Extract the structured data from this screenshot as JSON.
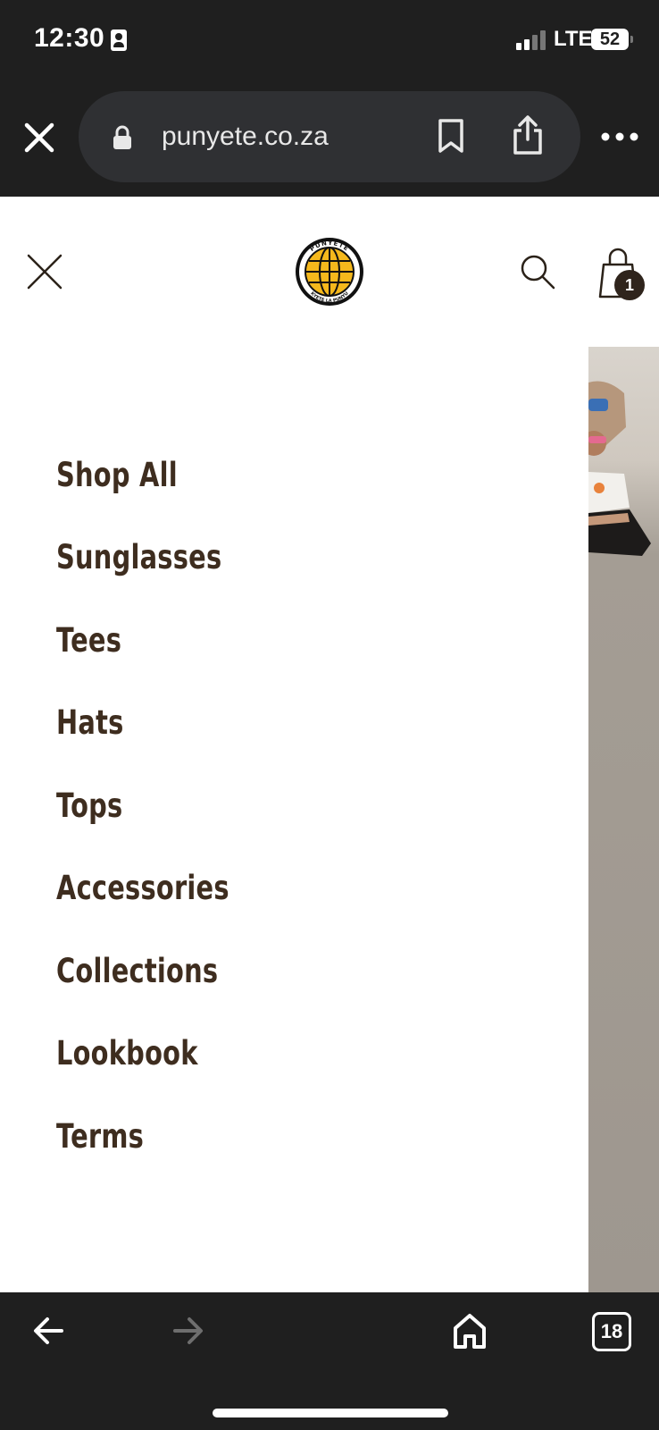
{
  "status_bar": {
    "time": "12:30",
    "network": "LTE",
    "battery": "52"
  },
  "browser": {
    "url": "punyete.co.za",
    "tab_count": "18"
  },
  "site": {
    "logo_text_top": "PUNYETE",
    "logo_text_bottom": "KYETE LA PUNYU",
    "cart_count": "1"
  },
  "menu": {
    "items": [
      {
        "label": "Shop All"
      },
      {
        "label": "Sunglasses"
      },
      {
        "label": "Tees"
      },
      {
        "label": "Hats"
      },
      {
        "label": "Tops"
      },
      {
        "label": "Accessories"
      },
      {
        "label": "Collections"
      },
      {
        "label": "Lookbook"
      },
      {
        "label": "Terms"
      }
    ]
  },
  "colors": {
    "chrome_bg": "#1f1f1f",
    "url_pill_bg": "#2f3033",
    "menu_text": "#3e2d1f",
    "logo_yellow": "#f5b81c",
    "cart_badge": "#2f241c"
  },
  "icons": {
    "browser_close": "close-icon",
    "lock": "lock-icon",
    "bookmark": "bookmark-icon",
    "share": "share-icon",
    "more": "more-icon",
    "site_close": "close-icon",
    "search": "search-icon",
    "cart": "shopping-bag-icon",
    "back": "back-arrow-icon",
    "forward": "forward-arrow-icon",
    "home": "home-icon"
  }
}
